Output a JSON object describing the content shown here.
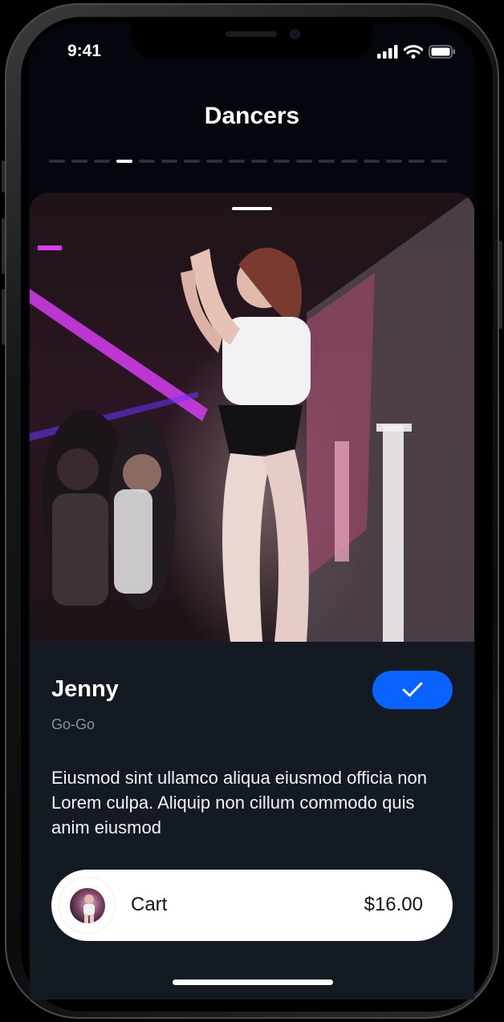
{
  "status_bar": {
    "time": "9:41"
  },
  "header": {
    "title": "Dancers"
  },
  "pager": {
    "count": 18,
    "active_index": 3
  },
  "dancer": {
    "name": "Jenny",
    "category": "Go-Go",
    "description": "Eiusmod sint ullamco aliqua eiusmod officia non Lorem culpa. Aliquip non cillum commodo quis anim eiusmod",
    "selected": true
  },
  "cart": {
    "label": "Cart",
    "total": "$16.00"
  },
  "colors": {
    "accent": "#0a63ff",
    "background": "#03070d",
    "card": "#141a22"
  },
  "icons": [
    "signal-icon",
    "wifi-icon",
    "battery-icon",
    "checkmark-icon"
  ]
}
